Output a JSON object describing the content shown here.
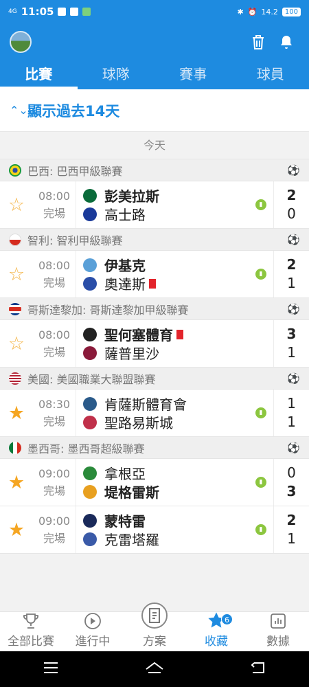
{
  "status_bar": {
    "signal": "4G",
    "time": "11:05",
    "speed": "14.2",
    "battery": "100"
  },
  "header": {
    "tabs": [
      {
        "label": "比賽",
        "active": true
      },
      {
        "label": "球隊",
        "active": false
      },
      {
        "label": "賽事",
        "active": false
      },
      {
        "label": "球員",
        "active": false
      }
    ]
  },
  "filter": {
    "label": "顯示過去14天"
  },
  "date_label": "今天",
  "leagues": [
    {
      "name": "巴西: 巴西甲級聯賽",
      "flag": "brazil",
      "matches": [
        {
          "favorite": false,
          "time": "08:00",
          "status": "完場",
          "home": "彭美拉斯",
          "away": "高士路",
          "home_score": "2",
          "away_score": "0",
          "home_red": false,
          "away_red": false,
          "stats": true,
          "home_logo_color": "#0a6b3a",
          "away_logo_color": "#1a3a9a"
        }
      ]
    },
    {
      "name": "智利: 智利甲級聯賽",
      "flag": "chile",
      "matches": [
        {
          "favorite": false,
          "time": "08:00",
          "status": "完場",
          "home": "伊基克",
          "away": "奧達斯",
          "home_score": "2",
          "away_score": "1",
          "home_red": false,
          "away_red": true,
          "stats": true,
          "home_logo_color": "#5aa0d8",
          "away_logo_color": "#2a4ea8"
        }
      ]
    },
    {
      "name": "哥斯達黎加: 哥斯達黎加甲級聯賽",
      "flag": "costa-rica",
      "matches": [
        {
          "favorite": false,
          "time": "08:00",
          "status": "完場",
          "home": "聖何塞體育",
          "away": "薩普里沙",
          "home_score": "3",
          "away_score": "1",
          "home_red": true,
          "away_red": false,
          "stats": false,
          "home_logo_color": "#222222",
          "away_logo_color": "#8a1a3a"
        }
      ]
    },
    {
      "name": "美國: 美國職業大聯盟聯賽",
      "flag": "usa",
      "matches": [
        {
          "favorite": true,
          "time": "08:30",
          "status": "完場",
          "home": "肯薩斯體育會",
          "away": "聖路易斯城",
          "home_score": "1",
          "away_score": "1",
          "home_red": false,
          "away_red": false,
          "stats": true,
          "home_logo_color": "#2a5a8a",
          "away_logo_color": "#c0304a"
        }
      ]
    },
    {
      "name": "墨西哥: 墨西哥超級聯賽",
      "flag": "mexico",
      "matches": [
        {
          "favorite": true,
          "time": "09:00",
          "status": "完場",
          "home": "拿根亞",
          "away": "堤格雷斯",
          "home_score": "0",
          "away_score": "3",
          "home_red": false,
          "away_red": false,
          "stats": true,
          "home_logo_color": "#2a8a3a",
          "away_logo_color": "#e8a020"
        },
        {
          "favorite": true,
          "time": "09:00",
          "status": "完場",
          "home": "蒙特雷",
          "away": "克雷塔羅",
          "home_score": "2",
          "away_score": "1",
          "home_red": false,
          "away_red": false,
          "stats": true,
          "home_logo_color": "#1a2a5a",
          "away_logo_color": "#3a5aa8"
        }
      ]
    }
  ],
  "bottom_nav": [
    {
      "label": "全部比賽",
      "icon": "trophy-icon",
      "active": false
    },
    {
      "label": "進行中",
      "icon": "play-icon",
      "active": false
    },
    {
      "label": "方案",
      "icon": "document-icon",
      "active": false
    },
    {
      "label": "收藏",
      "icon": "star-icon",
      "active": true,
      "badge": "6"
    },
    {
      "label": "數據",
      "icon": "chart-icon",
      "active": false
    }
  ],
  "colors": {
    "accent": "#1e8be0",
    "star": "#f5a623",
    "red_card": "#e3242b"
  }
}
